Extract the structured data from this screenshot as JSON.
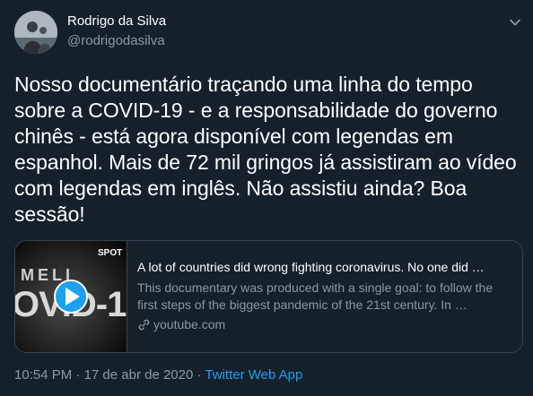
{
  "tweet": {
    "author": {
      "display_name": "Rodrigo da Silva",
      "handle": "@rodrigodasilva"
    },
    "text": "Nosso documentário traçando uma linha do tempo sobre a COVID-19 - e a responsabilidade do governo chinês - está agora disponível com legendas em espanhol. Mais de 72 mil gringos já assistiram ao vídeo com legendas em inglês. Não assistiu ainda? Boa sessão!",
    "card": {
      "thumbnail_text_brand": "SPOT",
      "thumbnail_text_line1": "MELI",
      "thumbnail_text_line2": "OVID-1",
      "title": "A lot of countries did wrong fighting coronavirus. No one did …",
      "description": "This documentary was produced with a single goal: to follow the first steps of the biggest pandemic of the 21st century. In …",
      "domain": "youtube.com"
    },
    "meta": {
      "time": "10:54 PM",
      "separator1": " · ",
      "date": "17 de abr de 2020",
      "separator2": " · ",
      "app": "Twitter Web App"
    }
  },
  "colors": {
    "background": "#15202b",
    "primary_text": "#ffffff",
    "secondary_text": "#8899a6",
    "accent": "#1da1f2",
    "border": "#38444d"
  },
  "icons": {
    "caret": "chevron-down-icon",
    "link": "link-icon",
    "play": "play-icon"
  }
}
